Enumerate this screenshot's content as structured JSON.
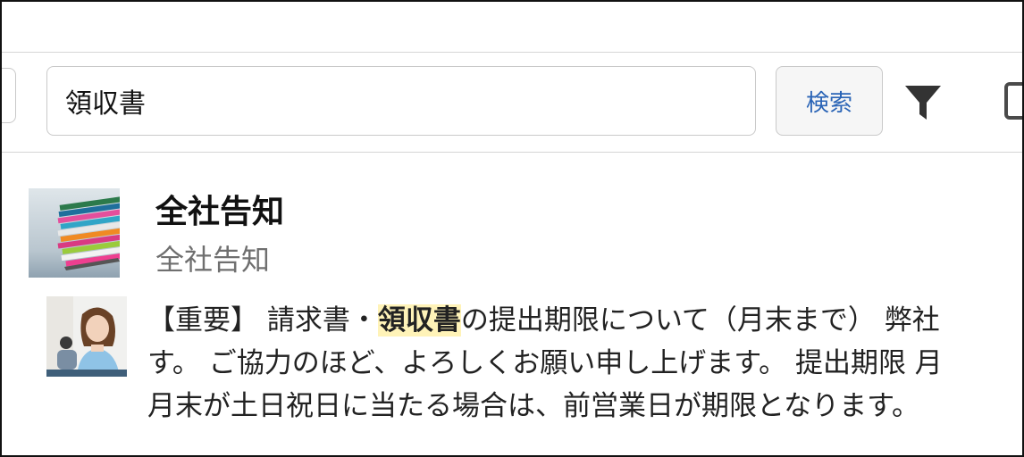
{
  "search": {
    "value": "領収書",
    "button_label": "検索",
    "filter_icon": "filter-icon"
  },
  "result": {
    "title": "全社告知",
    "subtitle": "全社告知",
    "snippet": {
      "line1_prefix": "【重要】 請求書・",
      "highlight": "領収書",
      "line1_suffix": "の提出期限について（月末まで） 弊社",
      "line2": "す。 ご協力のほど、よろしくお願い申し上げます。 提出期限 月",
      "line3": "月末が土日祝日に当たる場合は、前営業日が期限となります。"
    }
  },
  "colors": {
    "accent": "#2a64b6",
    "highlight": "#fff3b8"
  }
}
